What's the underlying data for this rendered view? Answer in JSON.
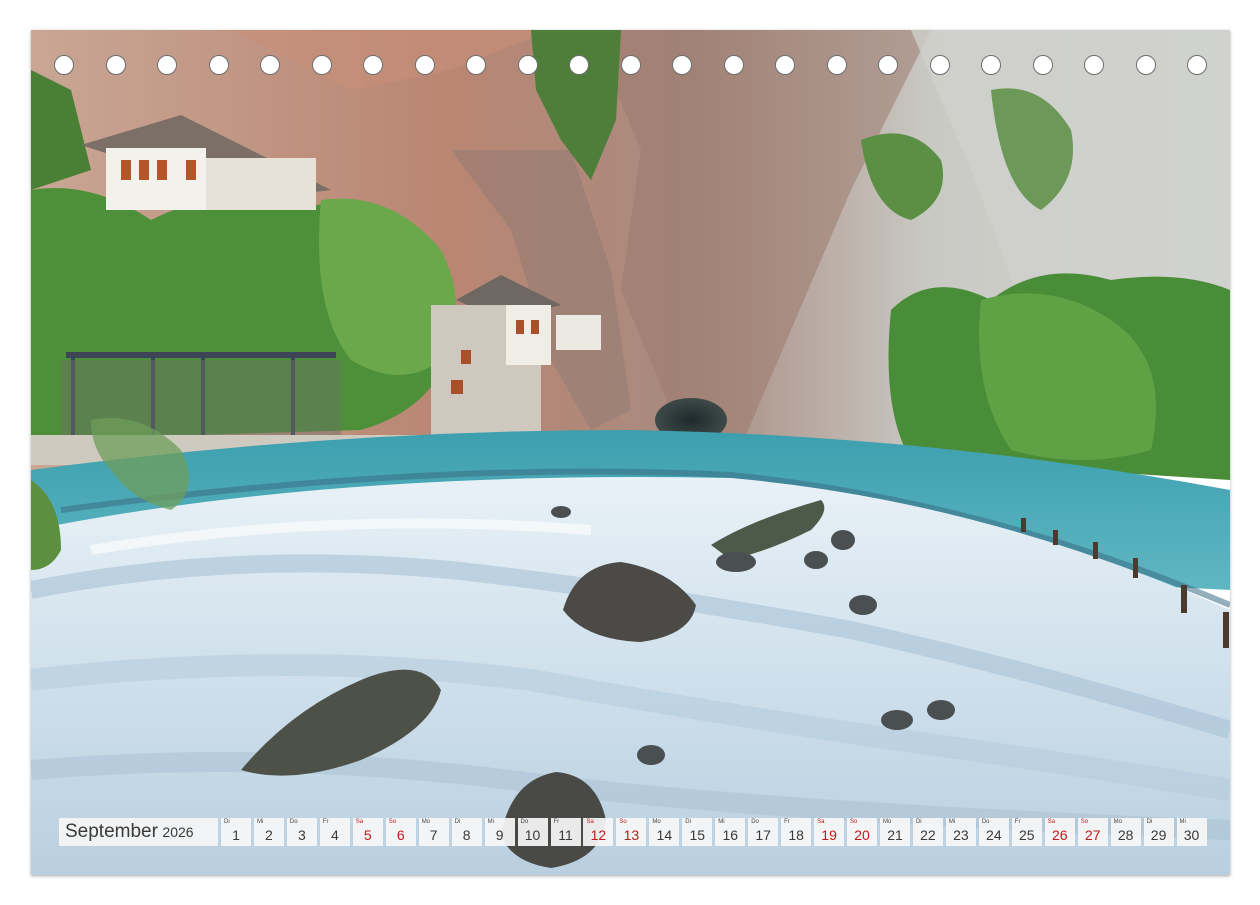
{
  "calendar": {
    "month": "September",
    "year": "2026",
    "days": [
      {
        "wd": "Di",
        "d": "1",
        "weekend": false
      },
      {
        "wd": "Mi",
        "d": "2",
        "weekend": false
      },
      {
        "wd": "Do",
        "d": "3",
        "weekend": false
      },
      {
        "wd": "Fr",
        "d": "4",
        "weekend": false
      },
      {
        "wd": "Sa",
        "d": "5",
        "weekend": true
      },
      {
        "wd": "So",
        "d": "6",
        "weekend": true
      },
      {
        "wd": "Mo",
        "d": "7",
        "weekend": false
      },
      {
        "wd": "Di",
        "d": "8",
        "weekend": false
      },
      {
        "wd": "Mi",
        "d": "9",
        "weekend": false
      },
      {
        "wd": "Do",
        "d": "10",
        "weekend": false
      },
      {
        "wd": "Fr",
        "d": "11",
        "weekend": false
      },
      {
        "wd": "Sa",
        "d": "12",
        "weekend": true
      },
      {
        "wd": "So",
        "d": "13",
        "weekend": true
      },
      {
        "wd": "Mo",
        "d": "14",
        "weekend": false
      },
      {
        "wd": "Di",
        "d": "15",
        "weekend": false
      },
      {
        "wd": "Mi",
        "d": "16",
        "weekend": false
      },
      {
        "wd": "Do",
        "d": "17",
        "weekend": false
      },
      {
        "wd": "Fr",
        "d": "18",
        "weekend": false
      },
      {
        "wd": "Sa",
        "d": "19",
        "weekend": true
      },
      {
        "wd": "So",
        "d": "20",
        "weekend": true
      },
      {
        "wd": "Mo",
        "d": "21",
        "weekend": false
      },
      {
        "wd": "Di",
        "d": "22",
        "weekend": false
      },
      {
        "wd": "Mi",
        "d": "23",
        "weekend": false
      },
      {
        "wd": "Do",
        "d": "24",
        "weekend": false
      },
      {
        "wd": "Fr",
        "d": "25",
        "weekend": false
      },
      {
        "wd": "Sa",
        "d": "26",
        "weekend": true
      },
      {
        "wd": "So",
        "d": "27",
        "weekend": true
      },
      {
        "wd": "Mo",
        "d": "28",
        "weekend": false
      },
      {
        "wd": "Di",
        "d": "29",
        "weekend": false
      },
      {
        "wd": "Mi",
        "d": "30",
        "weekend": false
      }
    ]
  },
  "colors": {
    "weekend_text": "#c11a1a",
    "water": "#4fa9b8",
    "cliff": "#b98e78",
    "foliage": "#4e8f3a"
  }
}
